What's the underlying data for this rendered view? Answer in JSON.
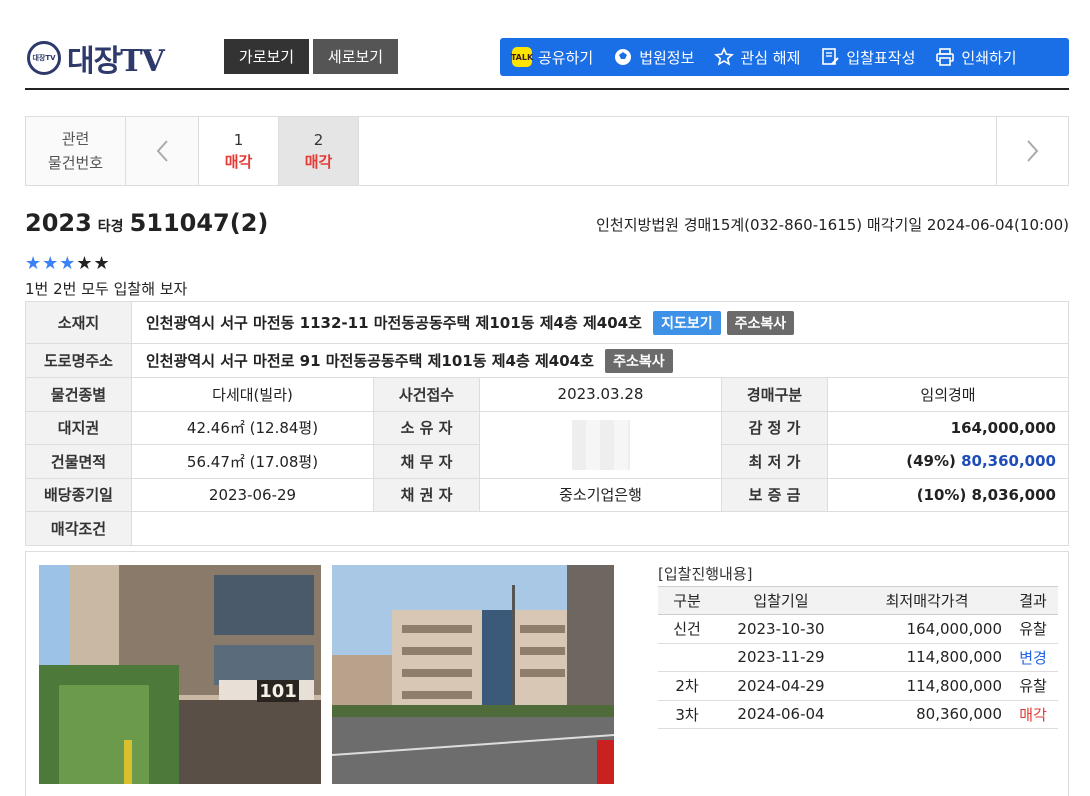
{
  "header": {
    "logo_badge": "대장TV",
    "logo_text": "대장TV",
    "view_horizontal": "가로보기",
    "view_vertical": "세로보기",
    "tools": {
      "share": "공유하기",
      "court": "법원정보",
      "unfavorite": "관심 해제",
      "bidform": "입찰표작성",
      "print": "인쇄하기",
      "kakao_icon_text": "TALK"
    }
  },
  "related": {
    "label_line1": "관련",
    "label_line2": "물건번호",
    "items": [
      {
        "no": "1",
        "status": "매각"
      },
      {
        "no": "2",
        "status": "매각"
      }
    ]
  },
  "case": {
    "year": "2023",
    "kind": "타경",
    "number": "511047(2)",
    "court_info": "인천지방법원 경매15계(032-860-1615) 매각기일 2024-06-04(10:00)",
    "stars_on": "★★★",
    "stars_off": "★★",
    "memo": "1번 2번 모두 입찰해 보자"
  },
  "info": {
    "location_label": "소재지",
    "location": "인천광역시 서구 마전동 1132-11 마전동공동주택 제101동 제4층 제404호",
    "map_btn": "지도보기",
    "copy_btn": "주소복사",
    "road_label": "도로명주소",
    "road": "인천광역시 서구 마전로 91 마전동공동주택 제101동 제4층 제404호",
    "type_label": "물건종별",
    "type": "다세대(빌라)",
    "received_label": "사건접수",
    "received": "2023.03.28",
    "auction_kind_label": "경매구분",
    "auction_kind": "임의경매",
    "land_label": "대지권",
    "land": "42.46㎡ (12.84평)",
    "owner_label": "소 유 자",
    "appraisal_label": "감 정 가",
    "appraisal": "164,000,000",
    "building_label": "건물면적",
    "building": "56.47㎡ (17.08평)",
    "debtor_label": "채 무 자",
    "min_label": "최 저 가",
    "min_pct": "(49%)",
    "min_price": "80,360,000",
    "dividend_label": "배당종기일",
    "dividend": "2023-06-29",
    "creditor_label": "채 권 자",
    "creditor": "중소기업은행",
    "deposit_label": "보 증 금",
    "deposit": "(10%) 8,036,000",
    "condition_label": "매각조건",
    "condition": ""
  },
  "bids": {
    "title": "[입찰진행내용]",
    "headers": [
      "구분",
      "입찰기일",
      "최저매각가격",
      "결과"
    ],
    "rows": [
      {
        "round": "신건",
        "date": "2023-10-30",
        "price": "164,000,000",
        "result": "유찰"
      },
      {
        "round": "",
        "date": "2023-11-29",
        "price": "114,800,000",
        "result": "변경"
      },
      {
        "round": "2차",
        "date": "2024-04-29",
        "price": "114,800,000",
        "result": "유찰"
      },
      {
        "round": "3차",
        "date": "2024-06-04",
        "price": "80,360,000",
        "result": "매각"
      }
    ]
  },
  "photos": {
    "photo1_sign": "101"
  },
  "colors": {
    "brand": "#2d3a6b",
    "toolbar": "#1b6fe6",
    "sold": "#e53935",
    "changed": "#2563eb",
    "min_price": "#1e4db7"
  }
}
